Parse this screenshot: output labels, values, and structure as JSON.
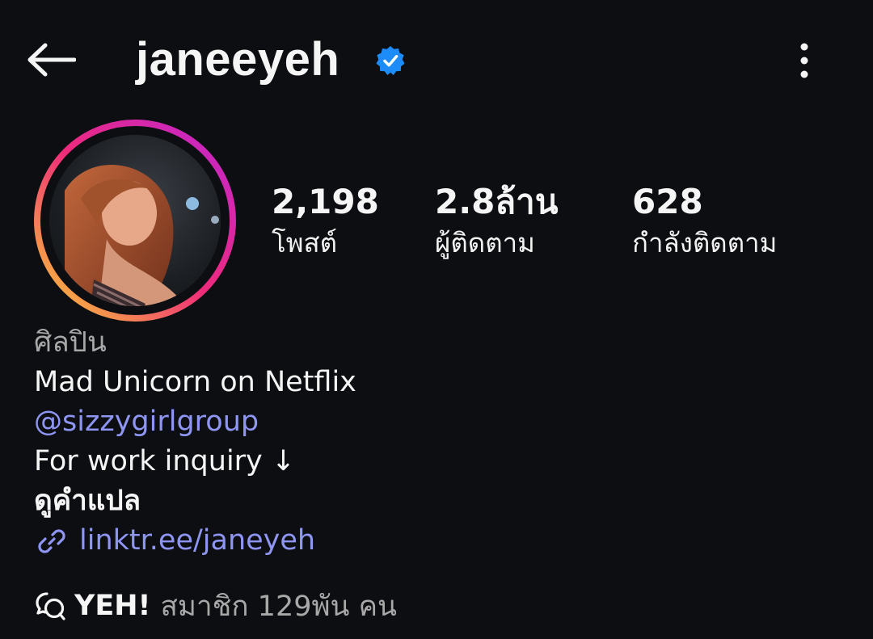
{
  "header": {
    "username": "janeeyeh",
    "back_icon": "arrow-left-icon",
    "verified_icon": "verified-badge-icon",
    "more_icon": "more-vertical-icon"
  },
  "colors": {
    "background": "#0c0e12",
    "text": "#f5f5f5",
    "muted": "#a8a8a8",
    "link": "#8e95f2",
    "verified": "#1d8cf8",
    "story_ring": [
      "#f9ce34",
      "#ee2a7b",
      "#c026d3"
    ]
  },
  "stats": {
    "posts": {
      "value": "2,198",
      "label": "โพสต์"
    },
    "followers": {
      "value": "2.8ล้าน",
      "label": "ผู้ติดตาม"
    },
    "following": {
      "value": "628",
      "label": "กำลังติดตาม"
    }
  },
  "bio": {
    "category": "ศิลปิน",
    "line1": "Mad Unicorn on Netflix",
    "mention": "@sizzygirlgroup",
    "line3": "For work inquiry ↓",
    "translate": "ดูคำแปล",
    "link": "linktr.ee/janeyeh",
    "link_icon": "link-icon"
  },
  "community": {
    "icon": "chat-bubbles-icon",
    "name": "YEH!",
    "members": "สมาชิก 129พัน คน"
  }
}
